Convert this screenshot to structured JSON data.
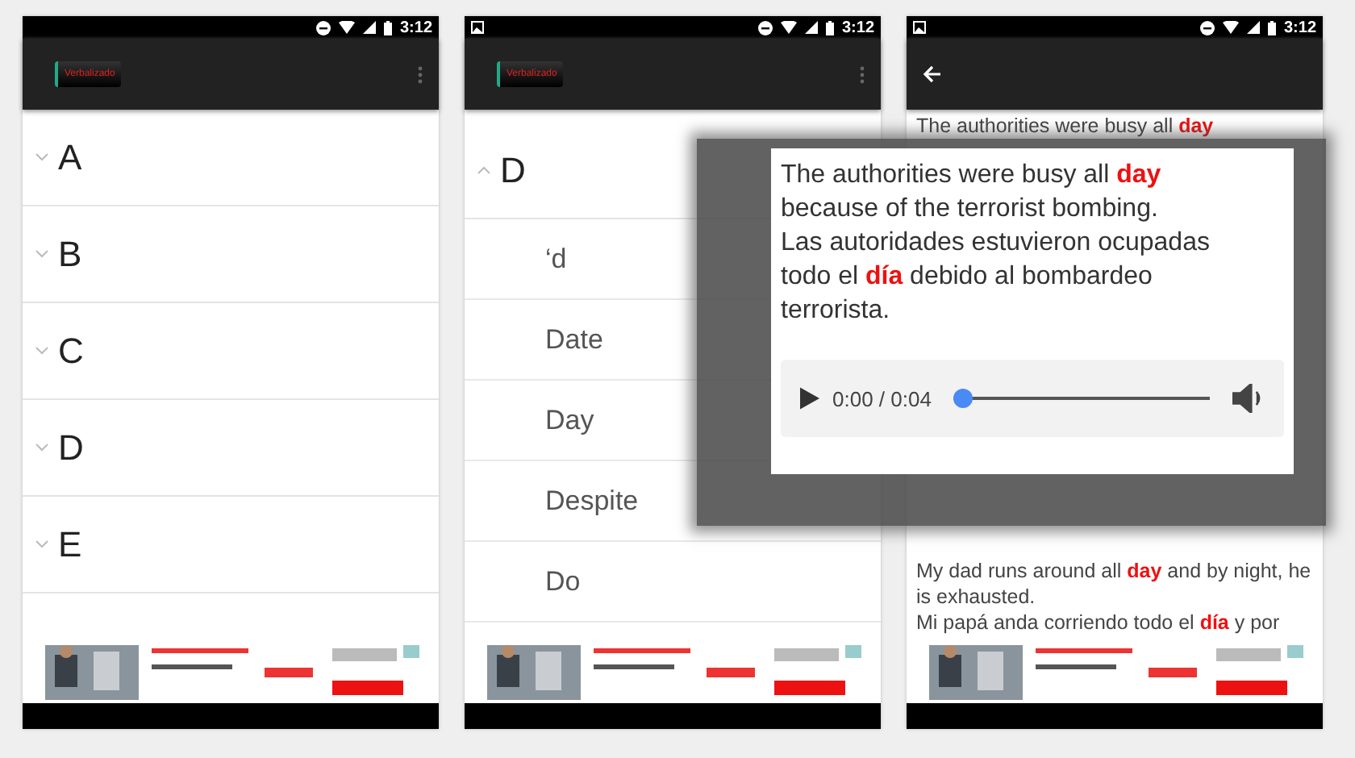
{
  "screens": [
    {
      "status_bar": {
        "time": "3:12",
        "notification": false
      },
      "app_bar": {
        "kind": "logo",
        "logo": "Verbalizado"
      },
      "content": {
        "kind": "list",
        "items": [
          {
            "label": "A",
            "expanded": false
          },
          {
            "label": "B",
            "expanded": false
          },
          {
            "label": "C",
            "expanded": false
          },
          {
            "label": "D",
            "expanded": false
          },
          {
            "label": "E",
            "expanded": false
          }
        ]
      }
    },
    {
      "status_bar": {
        "time": "3:12",
        "notification": true
      },
      "app_bar": {
        "kind": "logo",
        "logo": "Verbalizado"
      },
      "content": {
        "kind": "list",
        "items": [
          {
            "label": "D",
            "expanded": true,
            "children": [
              {
                "label": "‘d"
              },
              {
                "label": "Date"
              },
              {
                "label": "Day"
              },
              {
                "label": "Despite"
              },
              {
                "label": "Do"
              }
            ]
          }
        ]
      }
    },
    {
      "status_bar": {
        "time": "3:12",
        "notification": true
      },
      "app_bar": {
        "kind": "back"
      },
      "content": {
        "kind": "examples",
        "top_text": "The authorities were busy all **day**",
        "bottom_text": "My dad runs around all **day** and by night, he is exhausted.\nMi papá anda corriendo todo el **día**  y por"
      }
    }
  ],
  "popup": {
    "text": "The authorities were busy all **day** because of the terrorist bombing.\nLas autoridades estuvieron ocupadas todo el **día** debido al bombardeo terrorista.",
    "player": {
      "time": "0:00 / 0:04",
      "level": 0
    }
  }
}
